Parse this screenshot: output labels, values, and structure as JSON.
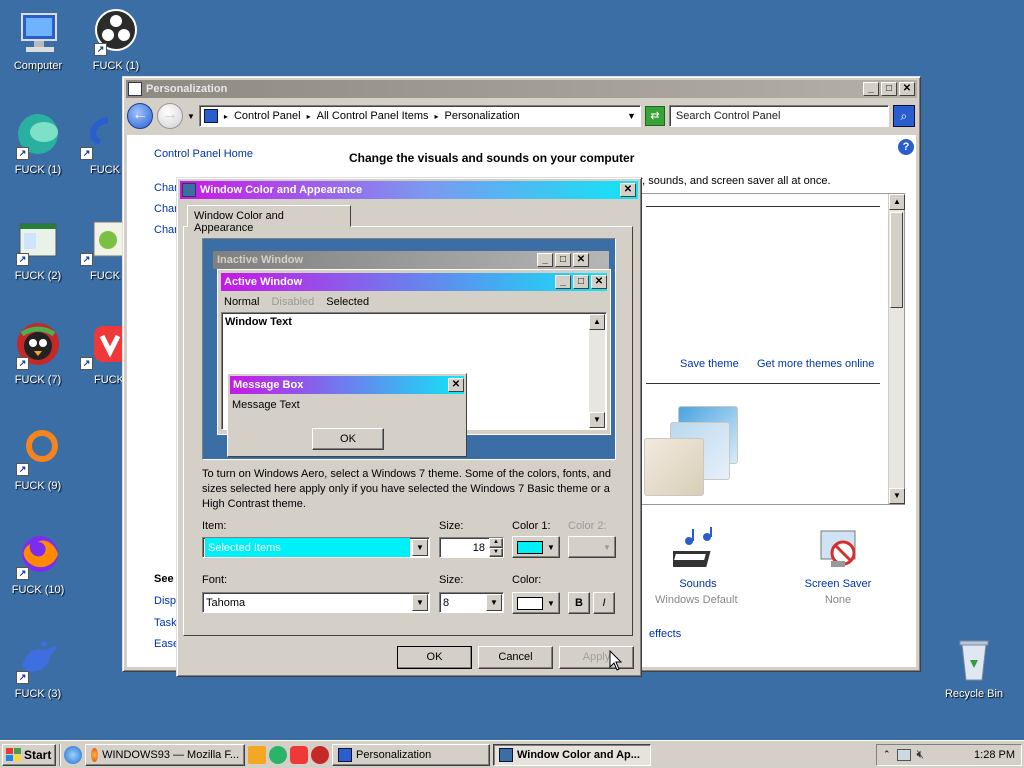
{
  "desktop": {
    "icons": [
      {
        "label": "Computer",
        "icon": "computer-icon"
      },
      {
        "label": "FUCK (1)",
        "icon": "obs-icon"
      },
      {
        "label": "FUCK (1)",
        "icon": "globe-app-icon"
      },
      {
        "label": "FUCK",
        "icon": "app-icon"
      },
      {
        "label": "FUCK (2)",
        "icon": "window-app-icon"
      },
      {
        "label": "FUCK",
        "icon": "frog-app-icon"
      },
      {
        "label": "FUCK (7)",
        "icon": "bird-icon"
      },
      {
        "label": "FUCK",
        "icon": "vivaldi-icon"
      },
      {
        "label": "FUCK (9)",
        "icon": "ring-icon"
      },
      {
        "label": "FUCK (10)",
        "icon": "firefox-icon"
      },
      {
        "label": "FUCK (3)",
        "icon": "blue-bird-icon"
      },
      {
        "label": "Recycle Bin",
        "icon": "recycle-bin-icon"
      }
    ]
  },
  "personalization": {
    "title": "Personalization",
    "breadcrumb": [
      "Control Panel",
      "All Control Panel Items",
      "Personalization"
    ],
    "search_placeholder": "Search Control Panel",
    "sidebar_home": "Control Panel Home",
    "sidebar_links": [
      "Char",
      "Char",
      "Char"
    ],
    "see_also": "See",
    "see_also_links": [
      "Displ",
      "Task",
      "Ease"
    ],
    "heading": "Change the visuals and sounds on your computer",
    "subheading": "or, sounds, and screen saver all at once.",
    "save_theme": "Save theme",
    "more_themes": "Get more themes online",
    "effects_link": "effects",
    "sounds": {
      "label": "Sounds",
      "value": "Windows Default"
    },
    "screensaver": {
      "label": "Screen Saver",
      "value": "None"
    }
  },
  "dialog": {
    "title": "Window Color and Appearance",
    "tab": "Window Color and Appearance",
    "preview": {
      "inactive_title": "Inactive Window",
      "active_title": "Active Window",
      "menu": [
        "Normal",
        "Disabled",
        "Selected"
      ],
      "window_text": "Window Text",
      "msgbox_title": "Message Box",
      "msgbox_text": "Message Text",
      "msgbox_ok": "OK"
    },
    "info": "To turn on Windows Aero, select a Windows 7 theme.  Some of the colors, fonts, and sizes selected here apply only if you have selected the Windows 7 Basic theme or a High Contrast theme.",
    "item_label": "Item:",
    "item_value": "Selected Items",
    "size_label": "Size:",
    "size_value": "18",
    "color1_label": "Color 1:",
    "color2_label": "Color 2:",
    "color1": "#00f0f8",
    "font_label": "Font:",
    "font_value": "Tahoma",
    "font_size_label": "Size:",
    "font_size_value": "8",
    "font_color_label": "Color:",
    "font_color": "#ffffff",
    "bold": "B",
    "italic": "I",
    "ok": "OK",
    "cancel": "Cancel",
    "apply": "Apply"
  },
  "taskbar": {
    "start": "Start",
    "tasks": [
      {
        "label": "WINDOWS93 — Mozilla F...",
        "active": false
      },
      {
        "label": "Personalization",
        "active": false
      },
      {
        "label": "Window Color and Ap...",
        "active": true
      }
    ],
    "clock": "1:28 PM"
  },
  "colors": {
    "desktop": "#3a6ea5",
    "selection": "#00f0f8",
    "title_gradient_start": "#c818e6",
    "title_gradient_end": "#10e6f5"
  }
}
